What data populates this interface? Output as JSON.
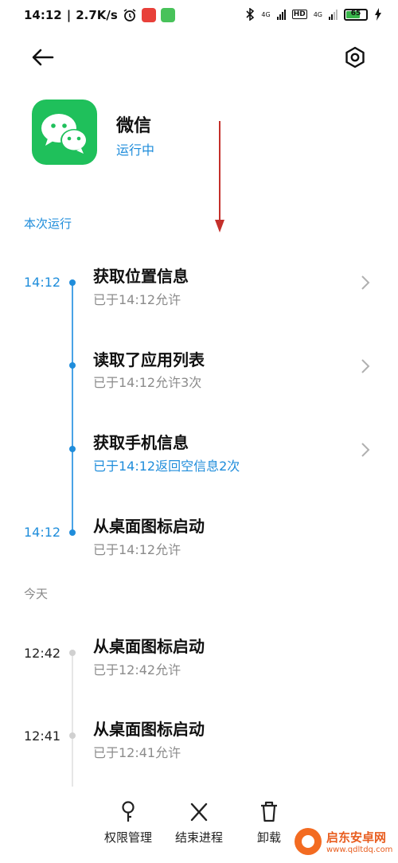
{
  "status_bar": {
    "time": "14:12",
    "speed": "2.7K/s",
    "signal1": "4G",
    "signal2": "4G",
    "hd": "HD",
    "battery": "65",
    "colors": {
      "app1": "#e8403a",
      "app2": "#48c25a"
    }
  },
  "header": {
    "back_icon": "back-arrow-icon",
    "settings_icon": "settings-gear-icon"
  },
  "app": {
    "name": "微信",
    "status": "运行中",
    "icon": "wechat-icon",
    "accent": "#1f8ddb",
    "icon_color": "#1fc05b"
  },
  "sections": {
    "current": "本次运行",
    "today": "今天"
  },
  "current_run": [
    {
      "time": "14:12",
      "title": "获取位置信息",
      "sub": "已于14:12允许",
      "has_chevron": true
    },
    {
      "time": "",
      "title": "读取了应用列表",
      "sub": "已于14:12允许3次",
      "has_chevron": true
    },
    {
      "time": "",
      "title": "获取手机信息",
      "sub": "已于14:12返回空信息2次",
      "has_chevron": true
    },
    {
      "time": "14:12",
      "title": "从桌面图标启动",
      "sub": "已于14:12允许",
      "has_chevron": false
    }
  ],
  "today_run": [
    {
      "time": "12:42",
      "title": "从桌面图标启动",
      "sub": "已于12:42允许"
    },
    {
      "time": "12:41",
      "title": "从桌面图标启动",
      "sub": "已于12:41允许"
    }
  ],
  "bottom_bar": {
    "permissions": "权限管理",
    "end_process": "结束进程",
    "uninstall": "卸载"
  },
  "watermark": {
    "name": "启东安卓网",
    "url": "www.qdltdq.com"
  }
}
